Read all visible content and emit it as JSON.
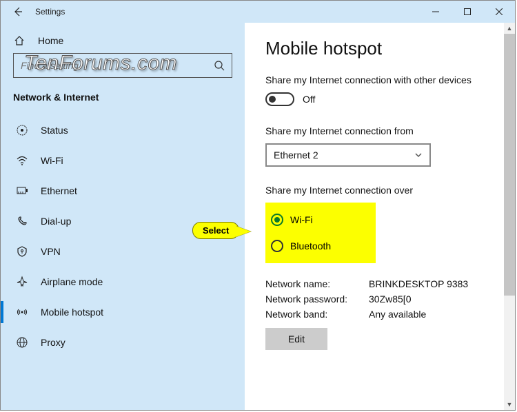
{
  "window": {
    "title": "Settings"
  },
  "watermark": "TenForums.com",
  "sidebar": {
    "home_label": "Home",
    "search_placeholder": "Find a setting",
    "category": "Network & Internet",
    "items": [
      {
        "label": "Status"
      },
      {
        "label": "Wi-Fi"
      },
      {
        "label": "Ethernet"
      },
      {
        "label": "Dial-up"
      },
      {
        "label": "VPN"
      },
      {
        "label": "Airplane mode"
      },
      {
        "label": "Mobile hotspot"
      },
      {
        "label": "Proxy"
      }
    ]
  },
  "main": {
    "title": "Mobile hotspot",
    "share_toggle_label": "Share my Internet connection with other devices",
    "toggle_state": "Off",
    "share_from_label": "Share my Internet connection from",
    "share_from_value": "Ethernet 2",
    "share_over_label": "Share my Internet connection over",
    "radios": [
      {
        "label": "Wi-Fi",
        "selected": true
      },
      {
        "label": "Bluetooth",
        "selected": false
      }
    ],
    "info": {
      "name_label": "Network name:",
      "name_value": "BRINKDESKTOP 9383",
      "password_label": "Network password:",
      "password_value": "30Zw85[0",
      "band_label": "Network band:",
      "band_value": "Any available"
    },
    "edit_label": "Edit"
  },
  "callout": {
    "label": "Select"
  }
}
